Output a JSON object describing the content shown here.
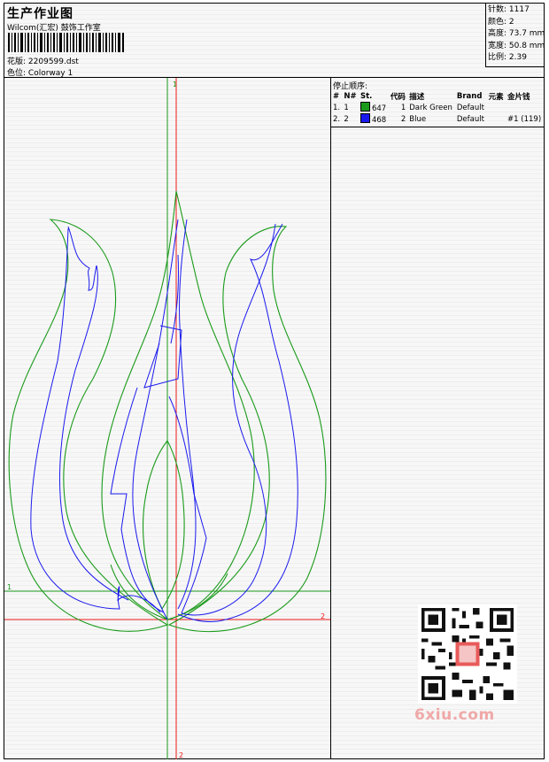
{
  "header": {
    "title": "生产作业图",
    "company": "Wilcom(汇宏) 鼓饰工作室",
    "design_label": "花版:",
    "design_file": "2209599.dst",
    "colorway_label": "色位:",
    "colorway": "Colorway 1"
  },
  "stats": {
    "stitches": "针数: 1117",
    "colors": "颜色: 2",
    "height": "高度: 73.7 mm",
    "width": "宽度: 50.8 mm",
    "scale": "比例: 2.39"
  },
  "stop_sequence": {
    "title": "停止顺序:",
    "columns": [
      "#",
      "N#",
      "St.",
      "代码",
      "描述",
      "Brand",
      "元素",
      "金片钱"
    ],
    "rows": [
      {
        "num": "1.",
        "n": "1",
        "swatch": "#1a9a1a",
        "stitches": "647",
        "code": "1",
        "desc": "Dark Green",
        "brand": "Default",
        "element": "",
        "sequin": ""
      },
      {
        "num": "2.",
        "n": "2",
        "swatch": "#1a1aee",
        "stitches": "468",
        "code": "2",
        "desc": "Blue",
        "brand": "Default",
        "element": "",
        "sequin": "#1 (119)"
      }
    ]
  },
  "axes": {
    "green_v_label": "1",
    "green_h_label": "1",
    "red_h_label": "2",
    "red_v_label": "2"
  },
  "colors": {
    "green": "#1a9a1a",
    "blue": "#1a1aee",
    "red": "#ee1a1a"
  },
  "watermark": "6xiu.com"
}
